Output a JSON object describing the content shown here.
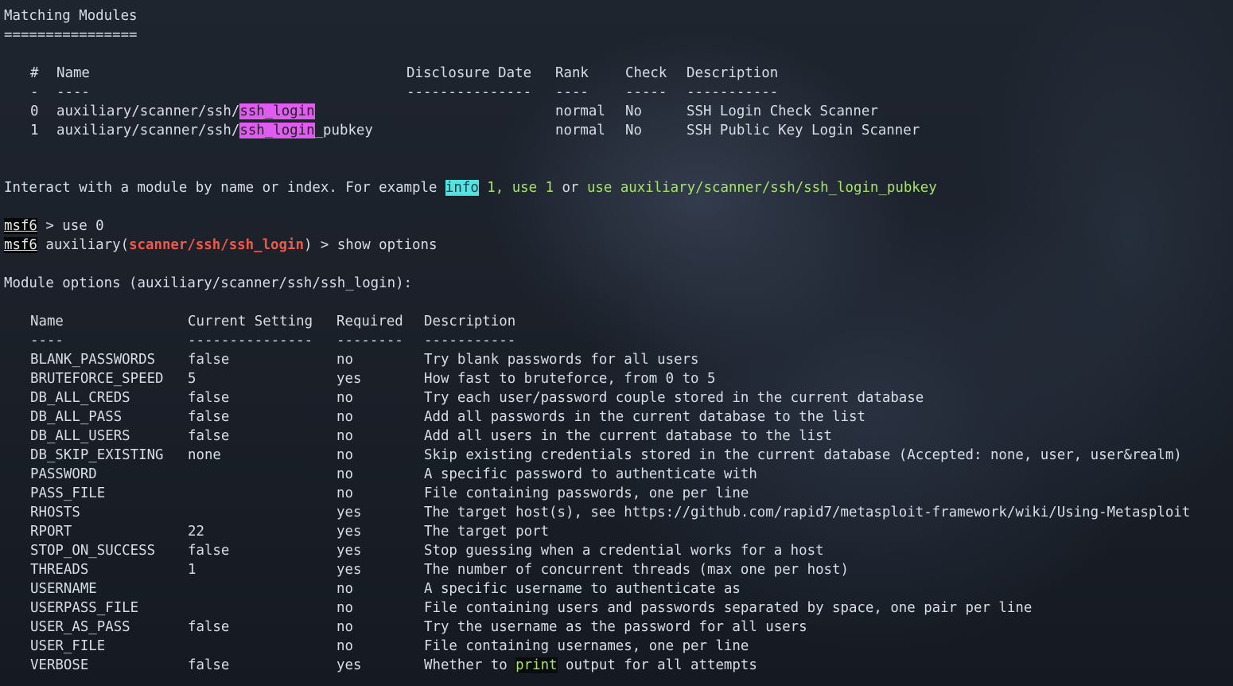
{
  "matching": {
    "title": "Matching Modules",
    "title_underline": "================",
    "headers": {
      "num": "#",
      "name": "Name",
      "date": "Disclosure Date",
      "rank": "Rank",
      "check": "Check",
      "desc": "Description"
    },
    "dividers": {
      "num": "-",
      "name": "----",
      "date": "---------------",
      "rank": "----",
      "check": "-----",
      "desc": "-----------"
    },
    "rows": [
      {
        "num": "0",
        "prefix": "auxiliary/scanner/ssh/",
        "match": "ssh_login",
        "suffix": "",
        "date": "",
        "rank": "normal",
        "check": "No",
        "desc": "SSH Login Check Scanner"
      },
      {
        "num": "1",
        "prefix": "auxiliary/scanner/ssh/",
        "match": "ssh_login",
        "suffix": "_pubkey",
        "date": "",
        "rank": "normal",
        "check": "No",
        "desc": "SSH Public Key Login Scanner"
      }
    ]
  },
  "interact": {
    "text": "Interact with a module by name or index. For example ",
    "info_kw": "info",
    "num1": " 1, ",
    "use1": "use 1",
    "or": " or ",
    "use_path": "use auxiliary/scanner/ssh/ssh_login_pubkey"
  },
  "prompt1": {
    "prompt": "msf6",
    "text": " > use 0"
  },
  "prompt2": {
    "prompt": "msf6",
    "aux": " auxiliary(",
    "module": "scanner/ssh/ssh_login",
    "rest": ") > show options"
  },
  "options": {
    "title": "Module options (auxiliary/scanner/ssh/ssh_login):",
    "headers": {
      "name": "Name",
      "setting": "Current Setting",
      "required": "Required",
      "desc": "Description"
    },
    "dividers": {
      "name": "----",
      "setting": "---------------",
      "required": "--------",
      "desc": "-----------"
    },
    "rows": [
      {
        "name": "BLANK_PASSWORDS",
        "setting": "false",
        "required": "no",
        "desc": "Try blank passwords for all users"
      },
      {
        "name": "BRUTEFORCE_SPEED",
        "setting": "5",
        "required": "yes",
        "desc": "How fast to bruteforce, from 0 to 5"
      },
      {
        "name": "DB_ALL_CREDS",
        "setting": "false",
        "required": "no",
        "desc": "Try each user/password couple stored in the current database"
      },
      {
        "name": "DB_ALL_PASS",
        "setting": "false",
        "required": "no",
        "desc": "Add all passwords in the current database to the list"
      },
      {
        "name": "DB_ALL_USERS",
        "setting": "false",
        "required": "no",
        "desc": "Add all users in the current database to the list"
      },
      {
        "name": "DB_SKIP_EXISTING",
        "setting": "none",
        "required": "no",
        "desc": "Skip existing credentials stored in the current database (Accepted: none, user, user&realm)"
      },
      {
        "name": "PASSWORD",
        "setting": "",
        "required": "no",
        "desc": "A specific password to authenticate with"
      },
      {
        "name": "PASS_FILE",
        "setting": "",
        "required": "no",
        "desc": "File containing passwords, one per line"
      },
      {
        "name": "RHOSTS",
        "setting": "",
        "required": "yes",
        "desc": "The target host(s), see https://github.com/rapid7/metasploit-framework/wiki/Using-Metasploit"
      },
      {
        "name": "RPORT",
        "setting": "22",
        "required": "yes",
        "desc": "The target port"
      },
      {
        "name": "STOP_ON_SUCCESS",
        "setting": "false",
        "required": "yes",
        "desc": "Stop guessing when a credential works for a host"
      },
      {
        "name": "THREADS",
        "setting": "1",
        "required": "yes",
        "desc": "The number of concurrent threads (max one per host)"
      },
      {
        "name": "USERNAME",
        "setting": "",
        "required": "no",
        "desc": "A specific username to authenticate as"
      },
      {
        "name": "USERPASS_FILE",
        "setting": "",
        "required": "no",
        "desc": "File containing users and passwords separated by space, one pair per line"
      },
      {
        "name": "USER_AS_PASS",
        "setting": "false",
        "required": "no",
        "desc": "Try the username as the password for all users"
      },
      {
        "name": "USER_FILE",
        "setting": "",
        "required": "no",
        "desc": "File containing usernames, one per line"
      },
      {
        "name": "VERBOSE",
        "setting": "false",
        "required": "yes",
        "desc_pre": "Whether to ",
        "desc_kw": "print",
        "desc_post": " output for all attempts"
      }
    ]
  }
}
